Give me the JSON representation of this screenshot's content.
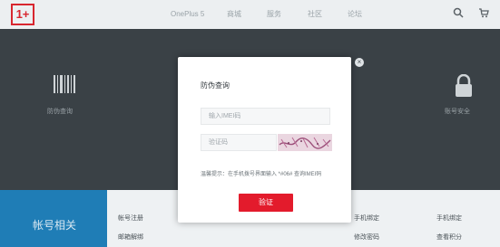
{
  "brand": {
    "logo_text": "1+",
    "logo_color": "#d8262f"
  },
  "nav": {
    "items": [
      "OnePlus 5",
      "商城",
      "服务",
      "社区",
      "论坛"
    ]
  },
  "hero": {
    "left_label": "防伪查询",
    "right_label": "账号安全"
  },
  "bottom": {
    "title": "帐号相关",
    "links": [
      "帐号注册",
      "邮箱解绑",
      "手机绑定",
      "修改密码",
      "手机绑定",
      "查看积分"
    ]
  },
  "modal": {
    "title": "防伪查询",
    "imei_placeholder": "输入IMEI码",
    "code_placeholder": "验证码",
    "tip": "温馨提示：在手机拨号界面输入 *#06# 查询IMEI码",
    "verify_label": "验证"
  },
  "colors": {
    "accent": "#e31b2c",
    "bottom_left_bg": "#1f7db6"
  },
  "icons": {
    "search": "search-icon",
    "cart": "cart-icon",
    "close": "close-icon",
    "barcode": "barcode-icon",
    "lock": "lock-icon"
  }
}
